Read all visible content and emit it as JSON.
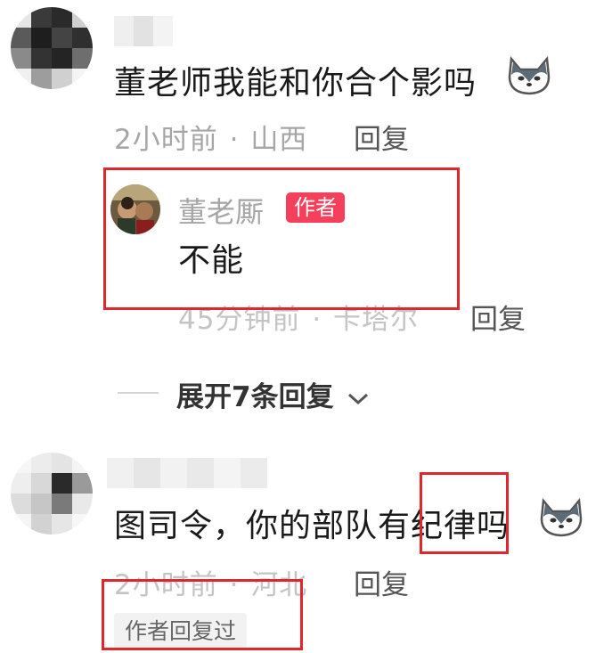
{
  "comments": [
    {
      "text": "董老师我能和你合个影吗",
      "time": "2小时前",
      "sep": "·",
      "location": "山西",
      "reply_label": "回复",
      "reply": {
        "author": "董老厮",
        "badge": "作者",
        "text": "不能",
        "time": "45分钟前",
        "sep": "·",
        "location": "卡塔尔",
        "reply_label": "回复"
      },
      "expand_label": "展开7条回复",
      "expand_chevron": "chevron-down-icon"
    },
    {
      "text": "图司令，你的部队有纪律吗",
      "time": "2小时前",
      "sep": "·",
      "location": "河北",
      "reply_label": "回复",
      "author_replied_chip": "作者回复过"
    }
  ],
  "colors": {
    "highlight_box": "#e0272b",
    "badge_bg": "#f5405c",
    "meta_text": "#a6a6a6"
  }
}
